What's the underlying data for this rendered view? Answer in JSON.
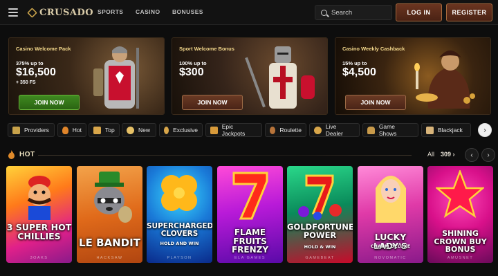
{
  "header": {
    "logo": "CRUSADO",
    "nav": [
      "SPORTS",
      "CASINO",
      "BONUSES"
    ],
    "search_placeholder": "Search",
    "login": "LOG IN",
    "register": "REGISTER"
  },
  "promos": [
    {
      "tag": "Casino Welcome Pack",
      "sub": "375% up to",
      "amount": "$16,500",
      "extra": "+ 350 FS",
      "button": "JOIN NOW",
      "button_color": "#3f8a20"
    },
    {
      "tag": "Sport Welcome Bonus",
      "sub": "100% up to",
      "amount": "$300",
      "extra": "",
      "button": "JOIN NOW",
      "button_color": "#6a3a24"
    },
    {
      "tag": "Casino Weekly Cashback",
      "sub": "15% up to",
      "amount": "$4,500",
      "extra": "",
      "button": "JOIN NOW",
      "button_color": "#6a3a24"
    }
  ],
  "categories": [
    {
      "label": "Providers",
      "icon": "book-icon"
    },
    {
      "label": "Hot",
      "icon": "flame-icon"
    },
    {
      "label": "Top",
      "icon": "crown-icon"
    },
    {
      "label": "New",
      "icon": "sparkle-icon"
    },
    {
      "label": "Exclusive",
      "icon": "star-burst-icon"
    },
    {
      "label": "Epic Jackpots",
      "icon": "coins-icon"
    },
    {
      "label": "Roulette",
      "icon": "roulette-icon"
    },
    {
      "label": "Live Dealer",
      "icon": "chip-icon"
    },
    {
      "label": "Game Shows",
      "icon": "microphone-icon"
    },
    {
      "label": "Blackjack",
      "icon": "cards-icon"
    }
  ],
  "hot": {
    "title": "HOT",
    "all_label": "All",
    "count": "309 ›"
  },
  "games": [
    {
      "title": "3 SUPER HOT CHILLIES",
      "sub": "",
      "provider": "3OAKS"
    },
    {
      "title": "LE BANDIT",
      "sub": "",
      "provider": "HACKSAW"
    },
    {
      "title": "SUPERCHARGED CLOVERS",
      "sub": "HOLD AND WIN",
      "provider": "PLAYSON"
    },
    {
      "title": "FLAME FRUITS FRENZY",
      "sub": "",
      "provider": "ELA GAMES"
    },
    {
      "title": "GOLDFORTUNE POWER",
      "sub": "HOLD & WIN",
      "provider": "GAMEBEAT"
    },
    {
      "title": "LUCKY LADY'S",
      "sub": "CHARM DELUXE",
      "provider": "NOVOMATIC"
    },
    {
      "title": "SHINING CROWN BUY BONUS",
      "sub": "",
      "provider": "AMUSNET"
    }
  ]
}
